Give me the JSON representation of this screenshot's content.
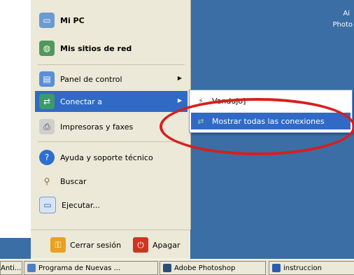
{
  "desktop": {
    "top_right_label": "Photo",
    "top_right_small": "Ai"
  },
  "start_menu": {
    "items": [
      {
        "label": "Mi PC",
        "icon": "computer-icon",
        "bold": true
      },
      {
        "label": "Mis sitios de red",
        "icon": "network-places-icon",
        "bold": true
      },
      {
        "label": "Panel de control",
        "icon": "control-panel-icon",
        "bold": false
      },
      {
        "label": "Conectar a",
        "icon": "connect-to-icon",
        "bold": false
      },
      {
        "label": "Impresoras y faxes",
        "icon": "printers-icon",
        "bold": false
      },
      {
        "label": "Ayuda y soporte técnico",
        "icon": "help-icon",
        "bold": false
      },
      {
        "label": "Buscar",
        "icon": "search-icon",
        "bold": false
      },
      {
        "label": "Ejecutar...",
        "icon": "run-icon",
        "bold": false
      }
    ],
    "logoff_label": "Cerrar sesión",
    "shutdown_label": "Apagar"
  },
  "submenu": {
    "items": [
      {
        "label": "Vandujo]",
        "icon": "connection-icon"
      },
      {
        "label": "Mostrar todas las conexiones",
        "icon": "network-connections-icon"
      }
    ]
  },
  "taskbar": {
    "buttons": [
      {
        "label": "Anti..."
      },
      {
        "label": "Programa de Nuevas ..."
      },
      {
        "label": "Adobe Photoshop"
      },
      {
        "label": "instruccion"
      }
    ]
  },
  "colors": {
    "desktop_blue": "#3a6ea5",
    "highlight": "#316ac5",
    "annotation_red": "#d81e1e"
  }
}
